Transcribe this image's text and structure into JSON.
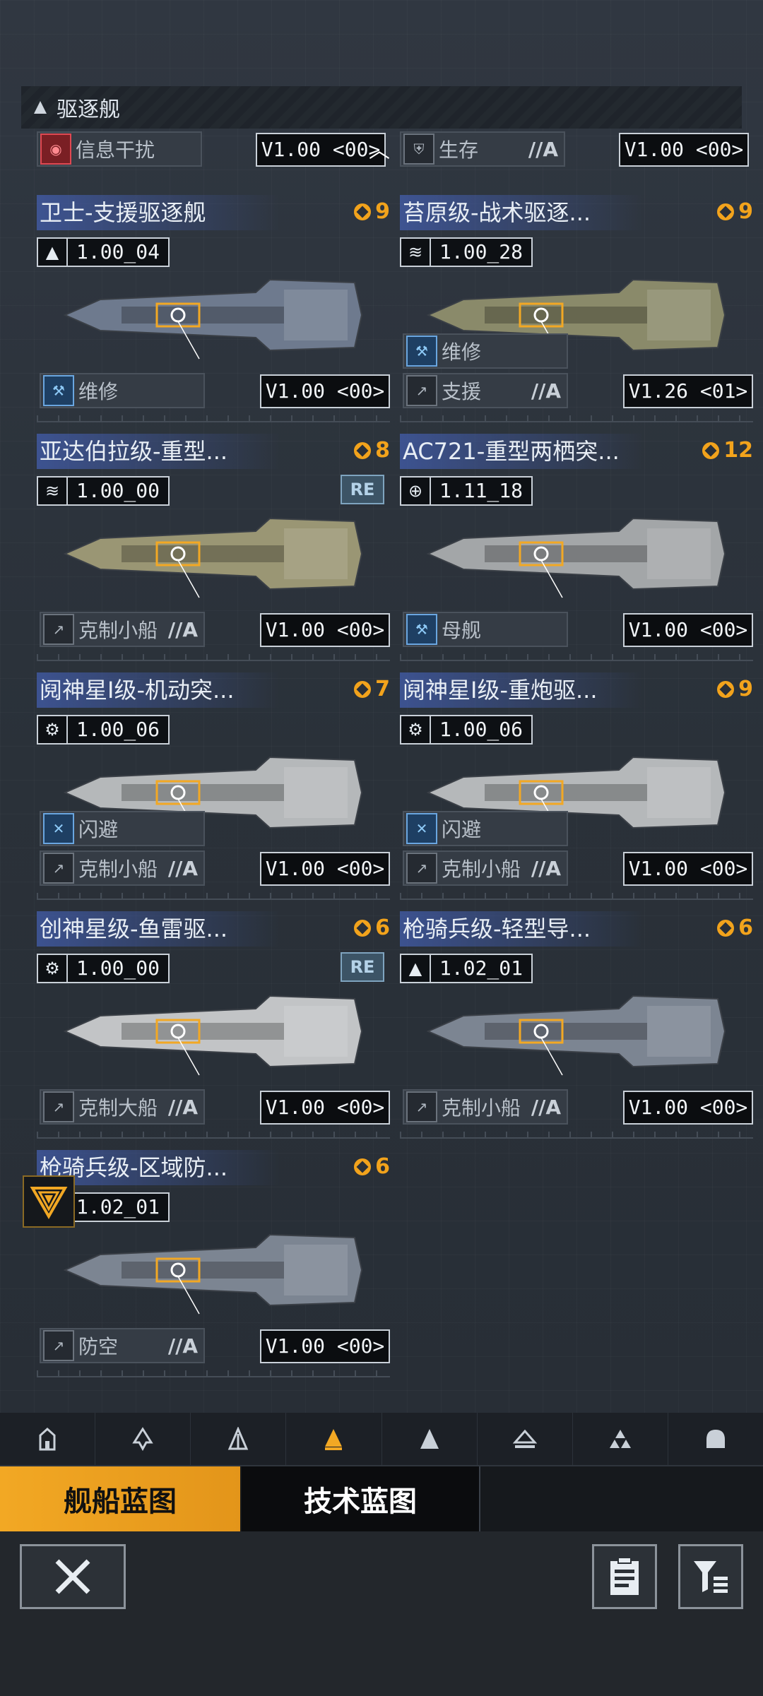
{
  "header": {
    "title": "驱逐舰"
  },
  "partial_row": {
    "left": {
      "tag": "信息干扰",
      "stat": "V1.00 <00>"
    },
    "right": {
      "tag": "生存",
      "grade": "//A",
      "stat": "V1.00 <00>"
    }
  },
  "cards": [
    {
      "title": "卫士-支援驱逐舰",
      "cost": "9",
      "version": "1.00_04",
      "skill": "",
      "tag": "维修",
      "grade": "",
      "stat": "V1.00 <00>",
      "re": ""
    },
    {
      "title": "苔原级-战术驱逐...",
      "cost": "9",
      "version": "1.00_28",
      "skill": "维修",
      "tag": "支援",
      "grade": "//A",
      "stat": "V1.26 <01>",
      "re": ""
    },
    {
      "title": "亚达伯拉级-重型...",
      "cost": "8",
      "version": "1.00_00",
      "skill": "",
      "tag": "克制小船",
      "grade": "//A",
      "stat": "V1.00 <00>",
      "re": "RE"
    },
    {
      "title": "AC721-重型两栖突...",
      "cost": "12",
      "version": "1.11_18",
      "skill": "",
      "tag": "母舰",
      "grade": "",
      "stat": "V1.00 <00>",
      "re": ""
    },
    {
      "title": "阋神星I级-机动突...",
      "cost": "7",
      "version": "1.00_06",
      "skill": "闪避",
      "tag": "克制小船",
      "grade": "//A",
      "stat": "V1.00 <00>",
      "re": ""
    },
    {
      "title": "阋神星I级-重炮驱...",
      "cost": "9",
      "version": "1.00_06",
      "skill": "闪避",
      "tag": "克制小船",
      "grade": "//A",
      "stat": "V1.00 <00>",
      "re": ""
    },
    {
      "title": "创神星级-鱼雷驱...",
      "cost": "6",
      "version": "1.00_00",
      "skill": "",
      "tag": "克制大船",
      "grade": "//A",
      "stat": "V1.00 <00>",
      "re": "RE"
    },
    {
      "title": "枪骑兵级-轻型导...",
      "cost": "6",
      "version": "1.02_01",
      "skill": "",
      "tag": "克制小船",
      "grade": "//A",
      "stat": "V1.00 <00>",
      "re": ""
    },
    {
      "title": "枪骑兵级-区域防...",
      "cost": "6",
      "version": "1.02_01",
      "skill": "",
      "tag": "防空",
      "grade": "//A",
      "stat": "V1.00 <00>",
      "re": ""
    }
  ],
  "tabs": {
    "ship_blueprint": "舰船蓝图",
    "tech_blueprint": "技术蓝图"
  },
  "colors": {
    "accent": "#f2a824",
    "background": "#2a3038",
    "skill_blue": "#6aa6e0"
  }
}
